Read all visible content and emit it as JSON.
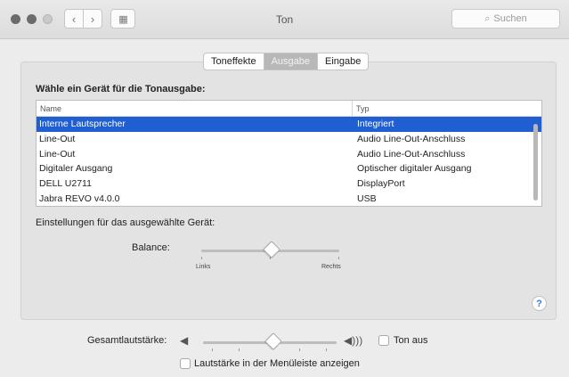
{
  "window": {
    "title": "Ton",
    "search_placeholder": "Suchen",
    "back_glyph": "‹",
    "forward_glyph": "›",
    "grid_glyph": "▦"
  },
  "tabs": [
    {
      "label": "Toneffekte",
      "active": false
    },
    {
      "label": "Ausgabe",
      "active": true
    },
    {
      "label": "Eingabe",
      "active": false
    }
  ],
  "output": {
    "section_title": "Wähle ein Gerät für die Tonausgabe:",
    "columns": {
      "name": "Name",
      "type": "Typ"
    },
    "devices": [
      {
        "name": "Interne Lautsprecher",
        "type": "Integriert",
        "selected": true
      },
      {
        "name": "Line-Out",
        "type": "Audio Line-Out-Anschluss",
        "selected": false
      },
      {
        "name": "Line-Out",
        "type": "Audio Line-Out-Anschluss",
        "selected": false
      },
      {
        "name": "Digitaler Ausgang",
        "type": "Optischer digitaler Ausgang",
        "selected": false
      },
      {
        "name": "DELL U2711",
        "type": "DisplayPort",
        "selected": false
      },
      {
        "name": "Jabra REVO v4.0.0",
        "type": "USB",
        "selected": false
      }
    ],
    "settings_label": "Einstellungen für das ausgewählte Gerät:",
    "balance": {
      "label": "Balance:",
      "left_label": "Links",
      "right_label": "Rechts",
      "value": 0.5
    },
    "help_glyph": "?"
  },
  "volume": {
    "label": "Gesamtlautstärke:",
    "value": 0.5,
    "speaker_low_glyph": "◀",
    "speaker_high_glyph": "◀)))",
    "mute_label": "Ton aus",
    "mute_checked": false,
    "show_in_menubar_label": "Lautstärke in der Menüleiste anzeigen",
    "show_in_menubar_checked": false
  },
  "colors": {
    "selection": "#1f5fd2",
    "active_tab": "#b8b8b8",
    "help_accent": "#3a7bd5"
  }
}
